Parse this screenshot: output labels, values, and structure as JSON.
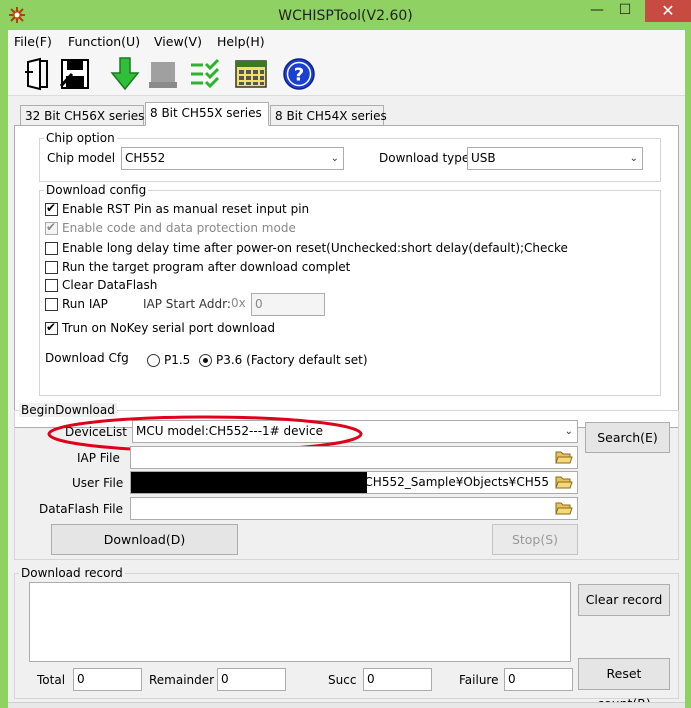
{
  "window": {
    "title": "WCHISPTool(V2.60)",
    "minimize": "—",
    "maximize": "☐",
    "close": "✕"
  },
  "menu": [
    "File(F)",
    "Function(U)",
    "View(V)",
    "Help(H)"
  ],
  "toolbar": {
    "icons": [
      "open-icon",
      "save-icon",
      "download-icon",
      "device-icon",
      "verify-icon",
      "calculator-icon",
      "help-icon"
    ],
    "help_glyph": "?"
  },
  "tabs": [
    "32 Bit CH56X series",
    "8 Bit CH55X series",
    "8 Bit CH54X series"
  ],
  "chip_option": {
    "title": "Chip option",
    "model_label": "Chip model",
    "model_value": "CH552",
    "type_label": "Download type",
    "type_value": "USB"
  },
  "download_config": {
    "title": "Download config",
    "options": [
      {
        "label": "Enable RST Pin as manual reset input pin",
        "checked": true,
        "disabled": false
      },
      {
        "label": "Enable code and data protection mode",
        "checked": true,
        "disabled": true
      },
      {
        "label": "Enable long delay time after power-on reset(Unchecked:short delay(default);Checke",
        "checked": false,
        "disabled": false
      },
      {
        "label": "Run the target program after download complet",
        "checked": false,
        "disabled": false
      },
      {
        "label": "Clear DataFlash",
        "checked": false,
        "disabled": false
      },
      {
        "label": "Run IAP",
        "checked": false,
        "disabled": false
      },
      {
        "label": "Trun on NoKey serial port download",
        "checked": true,
        "disabled": false
      }
    ],
    "iap_start_label": "IAP Start Addr:",
    "iap_prefix": "0x",
    "iap_value": "0",
    "cfg_label": "Download Cfg",
    "cfg_options": [
      {
        "label": "P1.5",
        "selected": false
      },
      {
        "label": "P3.6 (Factory default set)",
        "selected": true
      }
    ]
  },
  "begin": {
    "title": "BeginDownload",
    "device_label": "DeviceList",
    "device_value": "MCU model:CH552---1# device",
    "search_label": "Search(E)",
    "iap_label": "IAP File",
    "iap_value": "",
    "user_label": "User File",
    "user_value": "¥CH552_Sample¥Objects¥CH55",
    "dataflash_label": "DataFlash File",
    "dataflash_value": "",
    "download_label": "Download(D)",
    "stop_label": "Stop(S)"
  },
  "record": {
    "title": "Download record",
    "clear_label": "Clear record",
    "reset_label": "Reset count(R)",
    "total_label": "Total",
    "total": "0",
    "remainder_label": "Remainder",
    "remainder": "0",
    "succ_label": "Succ",
    "succ": "0",
    "failure_label": "Failure",
    "failure": "0"
  },
  "colors": {
    "titlebar": "#8fd163",
    "close": "#c74b40",
    "annotation": "#e0001b",
    "redact": "#000000"
  }
}
